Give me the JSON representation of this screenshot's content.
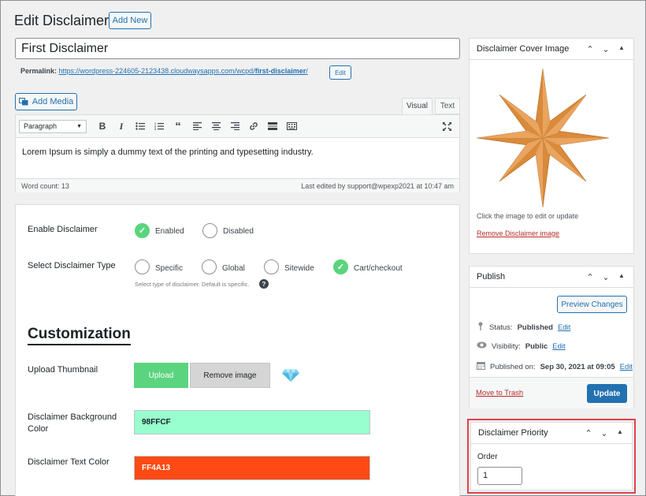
{
  "header": {
    "title": "Edit Disclaimer",
    "add_new_label": "Add New"
  },
  "post": {
    "title_value": "First Disclaimer",
    "permalink_label": "Permalink:",
    "permalink_base": "https://wordpress-224605-2123438.cloudwaysapps.com/wcpd/",
    "permalink_slug": "first-disclaimer",
    "permalink_trailing": "/",
    "permalink_edit_label": "Edit"
  },
  "editor": {
    "add_media_label": "Add Media",
    "tab_visual": "Visual",
    "tab_text": "Text",
    "format_select": "Paragraph",
    "content": "Lorem Ipsum is simply a dummy text of the printing and typesetting industry.",
    "word_count": "Word count: 13",
    "last_edited": "Last edited by support@wpexp2021 at 10:47 am"
  },
  "settings": {
    "enable_label": "Enable Disclaimer",
    "enable_options": [
      "Enabled",
      "Disabled"
    ],
    "enable_selected": "Enabled",
    "type_label": "Select Disclaimer Type",
    "type_options": [
      "Specific",
      "Global",
      "Sitewide",
      "Cart/checkout"
    ],
    "type_selected": "Cart/checkout",
    "type_hint": "Select type of disclaimer. Default is specific.",
    "help_glyph": "?"
  },
  "customization": {
    "heading": "Customization",
    "thumbnail_label": "Upload Thumbnail",
    "upload_label": "Upload",
    "remove_image_label": "Remove image",
    "thumbnail_icon": "diamond-icon",
    "bg_color_label": "Disclaimer Background Color",
    "bg_color_value": "98FFCF",
    "text_color_label": "Disclaimer Text Color",
    "text_color_value": "FF4A13",
    "colors": {
      "bg": "#98FFCF",
      "text": "#FF4A13",
      "upload_btn": "#5ad47f"
    }
  },
  "cover_image": {
    "title": "Disclaimer Cover Image",
    "hint": "Click the image to edit or update",
    "remove_label": "Remove Disclaimer image",
    "star_color": "#d98a3a"
  },
  "publish": {
    "title": "Publish",
    "preview_label": "Preview Changes",
    "status_label": "Status:",
    "status_value": "Published",
    "visibility_label": "Visibility:",
    "visibility_value": "Public",
    "published_label": "Published on:",
    "published_value": "Sep 30, 2021 at 09:05",
    "edit_label": "Edit",
    "trash_label": "Move to Trash",
    "update_label": "Update"
  },
  "priority": {
    "title": "Disclaimer Priority",
    "order_label": "Order",
    "order_value": "1"
  }
}
